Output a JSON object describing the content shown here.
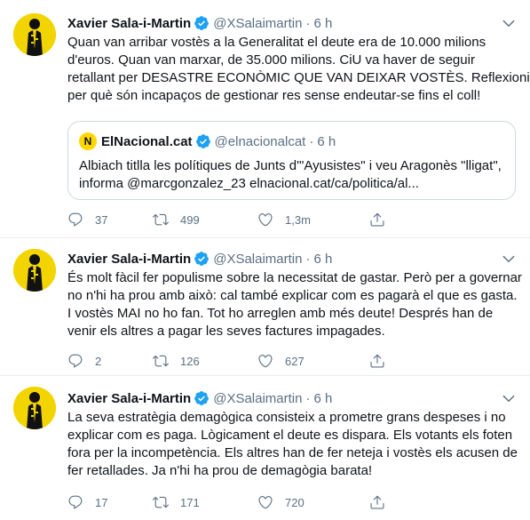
{
  "colors": {
    "verified": "#1da1f2",
    "secondary_text": "#5b7083",
    "divider": "#e6ecf0",
    "avatar_bg": "#f2d500"
  },
  "tweets": [
    {
      "author_name": "Xavier Sala-i-Martin",
      "handle": "@XSalaimartin",
      "separator": "·",
      "time": "6 h",
      "lines": [
        "Quan van arribar vostès a la Generalitat el deute era de 10.000 milions",
        "d'euros. Quan van marxar, de 35.000 milions. CiU va haver de seguir",
        "retallant per DESASTRE ECONÒMIC QUE VAN DEIXAR VOSTÈS. Reflexioni:",
        "per què són incapaços de gestionar res sense endeutar-se fins el coll!"
      ],
      "quote": {
        "logo_text": "N",
        "name": "ElNacional.cat",
        "handle": "@elnacionalcat",
        "separator": "·",
        "time": "6 h",
        "lines": [
          "Albiach titlla les polítiques de Junts d'\"Ayusistes\" i veu Aragonès \"lligat\",",
          "informa @marcgonzalez_23 elnacional.cat/ca/politica/al..."
        ]
      },
      "replies": "37",
      "retweets": "499",
      "likes": "1,3m"
    },
    {
      "author_name": "Xavier Sala-i-Martin",
      "handle": "@XSalaimartin",
      "separator": "·",
      "time": "6 h",
      "lines": [
        "És molt fàcil fer populisme sobre la necessitat de gastar. Però per a governar",
        "no n'hi ha prou amb això: cal també explicar com es pagarà el que es gasta.",
        "I vostès MAI no ho fan. Tot ho arreglen amb més deute! Després han de",
        "venir els altres a pagar les seves factures impagades."
      ],
      "replies": "2",
      "retweets": "126",
      "likes": "627"
    },
    {
      "author_name": "Xavier Sala-i-Martin",
      "handle": "@XSalaimartin",
      "separator": "·",
      "time": "6 h",
      "lines": [
        "La seva estratègia demagògica consisteix a prometre grans despeses i no",
        "explicar com es paga. Lògicament el deute es dispara. Els votants els foten",
        "fora per la incompetència. Els altres han de fer neteja i vostès els acusen de",
        "fer retallades. Ja n'hi ha prou de demagògia barata!"
      ],
      "replies": "17",
      "retweets": "171",
      "likes": "720"
    }
  ]
}
